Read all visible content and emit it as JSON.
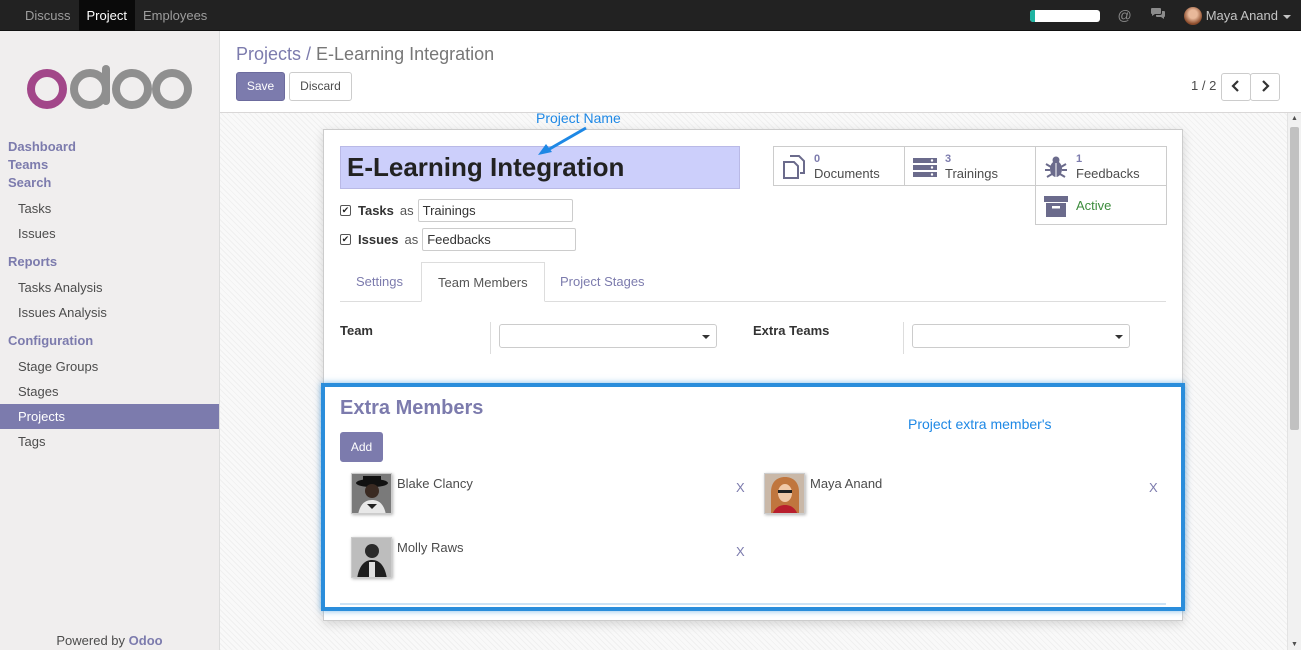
{
  "topbar": {
    "menu": [
      "Discuss",
      "Project",
      "Employees"
    ],
    "active_menu": "Project",
    "progress": 0.08,
    "at_icon": "@",
    "user": "Maya Anand"
  },
  "sidebar": {
    "logo": "odoo",
    "sections": {
      "dashboard": "Dashboard",
      "teams": "Teams",
      "search": "Search",
      "tasks": "Tasks",
      "issues": "Issues",
      "reports": "Reports",
      "tasks_analysis": "Tasks Analysis",
      "issues_analysis": "Issues Analysis",
      "configuration": "Configuration",
      "stage_groups": "Stage Groups",
      "stages": "Stages",
      "projects": "Projects",
      "tags": "Tags"
    },
    "powered_prefix": "Powered by",
    "powered_brand": "Odoo"
  },
  "control_panel": {
    "breadcrumb_parent": "Projects /",
    "breadcrumb_current": "E-Learning Integration",
    "save_label": "Save",
    "discard_label": "Discard",
    "pager": "1 / 2"
  },
  "form": {
    "project_name": "E-Learning Integration",
    "tasks_label": "Tasks",
    "tasks_as": "as",
    "tasks_alias": "Trainings",
    "issues_label": "Issues",
    "issues_as": "as",
    "issues_alias": "Feedbacks",
    "stats": {
      "documents_count": "0",
      "documents_label": "Documents",
      "trainings_count": "3",
      "trainings_label": "Trainings",
      "feedbacks_count": "1",
      "feedbacks_label": "Feedbacks",
      "active_label": "Active"
    },
    "tabs": [
      "Settings",
      "Team Members",
      "Project Stages"
    ],
    "active_tab": "Team Members",
    "team_label": "Team",
    "extra_teams_label": "Extra Teams",
    "extra_members_title": "Extra Members",
    "add_label": "Add",
    "members": [
      {
        "name": "Blake Clancy",
        "remove": "X"
      },
      {
        "name": "Maya Anand",
        "remove": "X"
      },
      {
        "name": "Molly Raws",
        "remove": "X"
      }
    ]
  },
  "annotations": {
    "project_name": "Project Name",
    "extra_members": "Project extra member's"
  },
  "colors": {
    "accent": "#7c7bad",
    "highlight": "#2a8ddb",
    "name_bg": "#cccffb",
    "active_green": "#3c8c3c"
  }
}
